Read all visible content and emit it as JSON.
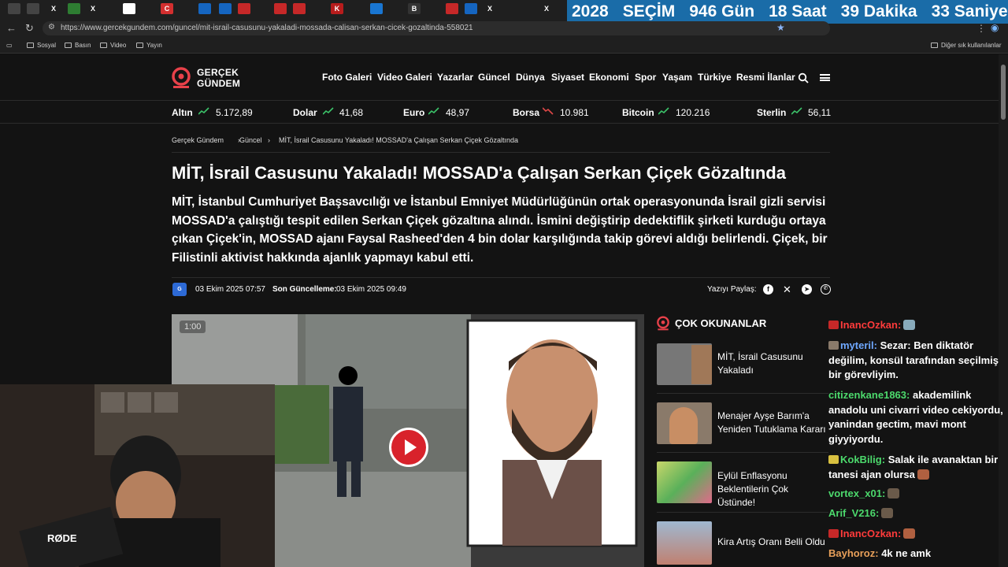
{
  "browser": {
    "url": "https://www.gercekgundem.com/guncel/mit-israil-casusunu-yakaladi-mossada-calisan-serkan-cicek-gozaltinda-558021",
    "bookmarks": [
      "Sosyal",
      "Basın",
      "Video",
      "Yayın"
    ],
    "bookmarks_right": "Diğer sık kullanılanlar"
  },
  "countdown": {
    "year": "2028",
    "label": "SEÇİM",
    "days": "946 Gün",
    "hours": "18 Saat",
    "minutes": "39 Dakika",
    "seconds": "33 Saniye"
  },
  "site": {
    "logo_line1": "GERÇEK",
    "logo_line2": "GÜNDEM",
    "nav": [
      "Foto Galeri",
      "Video Galeri",
      "Yazarlar",
      "Güncel",
      "Dünya",
      "Siyaset",
      "Ekonomi",
      "Spor",
      "Yaşam",
      "Türkiye",
      "Resmi İlanlar"
    ]
  },
  "ticker": [
    {
      "name": "Altın",
      "value": "5.172,89",
      "trend": "up"
    },
    {
      "name": "Dolar",
      "value": "41,68",
      "trend": "up"
    },
    {
      "name": "Euro",
      "value": "48,97",
      "trend": "up"
    },
    {
      "name": "Borsa",
      "value": "10.981",
      "trend": "down"
    },
    {
      "name": "Bitcoin",
      "value": "120.216",
      "trend": "up"
    },
    {
      "name": "Sterlin",
      "value": "56,11",
      "trend": "up"
    }
  ],
  "breadcrumb": [
    "Gerçek Gündem",
    "Güncel",
    "MİT, İsrail Casusunu Yakaladı! MOSSAD'a Çalışan Serkan Çiçek Gözaltında"
  ],
  "article": {
    "title": "MİT, İsrail Casusunu Yakaladı! MOSSAD'a Çalışan Serkan Çiçek Gözaltında",
    "lead": "MİT, İstanbul Cumhuriyet Başsavcılığı ve İstanbul Emniyet Müdürlüğünün ortak operasyonunda İsrail gizli servisi MOSSAD'a çalıştığı tespit edilen Serkan Çiçek gözaltına alındı. İsmini değiştirip dedektiflik şirketi kurduğu ortaya çıkan Çiçek'in, MOSSAD ajanı Faysal Rasheed'den 4 bin dolar karşılığında takip görevi aldığı belirlendi. Çiçek, bir Filistinli aktivist hakkında ajanlık yapmayı kabul etti.",
    "date": "03 Ekim 2025 07:57",
    "updated_label": "Son Güncelleme:",
    "updated": "03 Ekim 2025 09:49",
    "share_label": "Yazıyı Paylaş:",
    "video_time": "1:00"
  },
  "sidebar": {
    "title": "ÇOK OKUNANLAR",
    "items": [
      "MİT, İsrail Casusunu Yakaladı",
      "Menajer Ayşe Barım'a Yeniden Tutuklama Kararı",
      "Eylül Enflasyonu Beklentilerin Çok Üstünde!",
      "Kira Artış Oranı Belli Oldu"
    ]
  },
  "chat": [
    {
      "user": "InancOzkan:",
      "color": "#ff3b3b",
      "text": ""
    },
    {
      "user": "myteril:",
      "color": "#6fa8ff",
      "text": "Sezar: Ben diktatör değilim, konsül tarafından seçilmiş bir görevliyim."
    },
    {
      "user": "citizenkane1863:",
      "color": "#4cd96c",
      "text": "akademilink anadolu uni civarri video cekiyordu, yanindan gectim, mavi mont giyyiyordu."
    },
    {
      "user": "KokBilig:",
      "color": "#4cd96c",
      "text": "Salak ile avanaktan bir tanesi ajan olursa"
    },
    {
      "user": "vortex_x01:",
      "color": "#4cd96c",
      "text": ""
    },
    {
      "user": "Arif_V216:",
      "color": "#4cd96c",
      "text": ""
    },
    {
      "user": "InancOzkan:",
      "color": "#ff3b3b",
      "text": ""
    },
    {
      "user": "Bayhoroz:",
      "color": "#e8a05a",
      "text": "4k ne amk"
    }
  ],
  "colors": {
    "accent_red": "#d8222b",
    "countdown_bg": "#1a6ca8",
    "trend_up": "#3cc46a",
    "trend_down": "#e04848"
  }
}
